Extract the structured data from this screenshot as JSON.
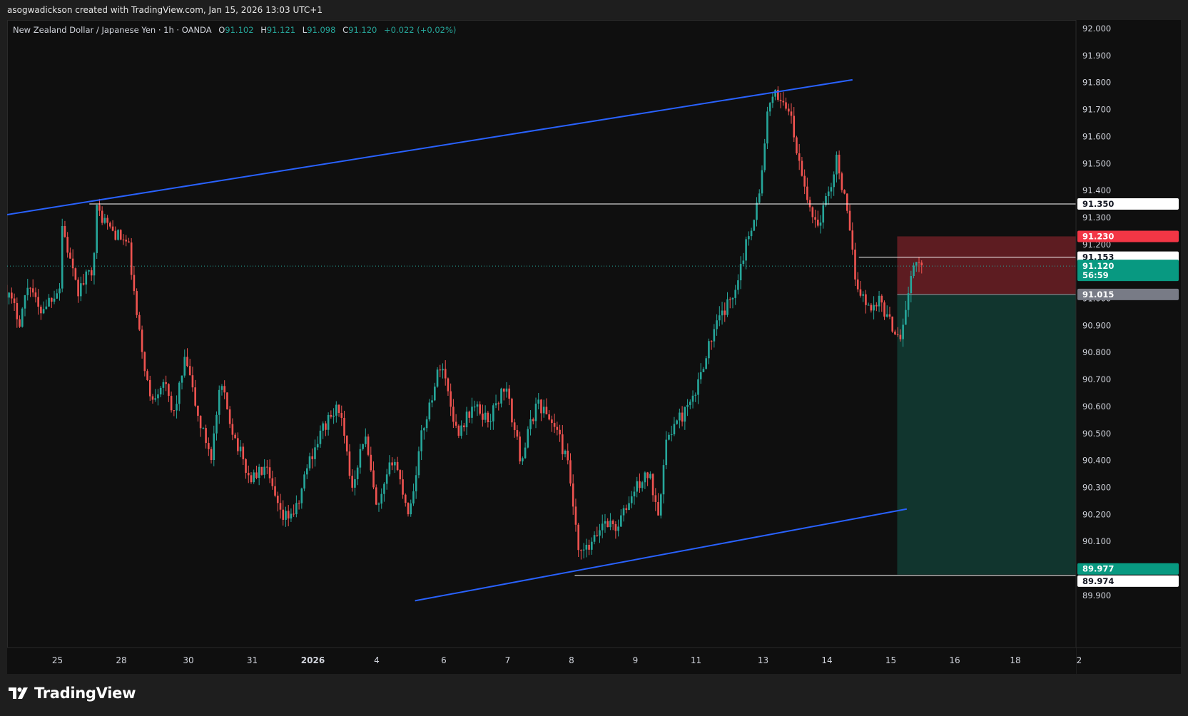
{
  "attribution": "asogwadickson created with TradingView.com, Jan 15, 2026 13:03 UTC+1",
  "legend": {
    "symbol": "New Zealand Dollar / Japanese Yen · 1h · OANDA",
    "o_label": "O",
    "o_value": "91.102",
    "h_label": "H",
    "h_value": "91.121",
    "l_label": "L",
    "l_value": "91.098",
    "c_label": "C",
    "c_value": "91.120",
    "change": "+0.022 (+0.02%)"
  },
  "logo_text": "TradingView",
  "colors": {
    "up": "#26a69a",
    "down": "#ef5350",
    "trendline": "#2962ff",
    "level": "#ffffff",
    "stop_zone": "#6b1f25",
    "target_zone": "#123a32",
    "stop_tag": "#f23645",
    "current_tag": "#089981",
    "entry_tag": "#787b86",
    "target_tag": "#089981"
  },
  "chart_data": {
    "type": "candlestick",
    "y_axis": {
      "range": [
        89.88,
        92.04
      ],
      "ticks": [
        "92.000",
        "91.900",
        "91.800",
        "91.700",
        "91.600",
        "91.500",
        "91.400",
        "91.300",
        "91.200",
        "91.100",
        "91.000",
        "90.900",
        "90.800",
        "90.700",
        "90.600",
        "90.500",
        "90.400",
        "90.300",
        "90.200",
        "90.100",
        "90.000",
        "89.900"
      ]
    },
    "x_axis": {
      "ticks": [
        {
          "label": "25",
          "t": 0.0
        },
        {
          "label": "28",
          "t": 1.0
        },
        {
          "label": "30",
          "t": 2.05
        },
        {
          "label": "31",
          "t": 3.05
        },
        {
          "label": "2026",
          "t": 4.0,
          "bold": true
        },
        {
          "label": "4",
          "t": 5.0
        },
        {
          "label": "6",
          "t": 6.05
        },
        {
          "label": "7",
          "t": 7.05
        },
        {
          "label": "8",
          "t": 8.05
        },
        {
          "label": "9",
          "t": 9.05
        },
        {
          "label": "11",
          "t": 10.0
        },
        {
          "label": "13",
          "t": 11.05
        },
        {
          "label": "14",
          "t": 12.05
        },
        {
          "label": "15",
          "t": 13.05
        },
        {
          "label": "16",
          "t": 14.05
        },
        {
          "label": "18",
          "t": 15.0
        },
        {
          "label": "2",
          "t": 16.0
        }
      ]
    },
    "price_path": [
      [
        -0.8,
        91.05
      ],
      [
        -0.55,
        90.92
      ],
      [
        -0.4,
        91.07
      ],
      [
        -0.25,
        90.95
      ],
      [
        0.1,
        91.05
      ],
      [
        0.1,
        91.29
      ],
      [
        0.35,
        91.02
      ],
      [
        0.6,
        91.12
      ],
      [
        0.65,
        91.33
      ],
      [
        0.9,
        91.25
      ],
      [
        1.15,
        91.2
      ],
      [
        1.3,
        90.9
      ],
      [
        1.5,
        90.62
      ],
      [
        1.7,
        90.7
      ],
      [
        1.85,
        90.56
      ],
      [
        2.05,
        90.78
      ],
      [
        2.25,
        90.55
      ],
      [
        2.45,
        90.42
      ],
      [
        2.6,
        90.68
      ],
      [
        2.8,
        90.5
      ],
      [
        3.05,
        90.33
      ],
      [
        3.3,
        90.37
      ],
      [
        3.55,
        90.18
      ],
      [
        3.8,
        90.22
      ],
      [
        3.95,
        90.38
      ],
      [
        4.2,
        90.52
      ],
      [
        4.45,
        90.6
      ],
      [
        4.65,
        90.3
      ],
      [
        4.85,
        90.5
      ],
      [
        5.05,
        90.2
      ],
      [
        5.3,
        90.42
      ],
      [
        5.55,
        90.2
      ],
      [
        5.75,
        90.5
      ],
      [
        6.05,
        90.77
      ],
      [
        6.3,
        90.5
      ],
      [
        6.55,
        90.6
      ],
      [
        6.8,
        90.55
      ],
      [
        7.05,
        90.68
      ],
      [
        7.3,
        90.4
      ],
      [
        7.55,
        90.62
      ],
      [
        7.85,
        90.52
      ],
      [
        8.05,
        90.37
      ],
      [
        8.2,
        90.05
      ],
      [
        8.4,
        90.08
      ],
      [
        8.6,
        90.18
      ],
      [
        8.8,
        90.15
      ],
      [
        9.1,
        90.3
      ],
      [
        9.3,
        90.35
      ],
      [
        9.45,
        90.22
      ],
      [
        9.6,
        90.5
      ],
      [
        9.8,
        90.56
      ],
      [
        10.0,
        90.62
      ],
      [
        10.2,
        90.8
      ],
      [
        10.4,
        90.92
      ],
      [
        10.6,
        91.0
      ],
      [
        10.85,
        91.22
      ],
      [
        11.05,
        91.4
      ],
      [
        11.15,
        91.68
      ],
      [
        11.3,
        91.76
      ],
      [
        11.5,
        91.7
      ],
      [
        11.65,
        91.5
      ],
      [
        11.8,
        91.35
      ],
      [
        11.95,
        91.27
      ],
      [
        12.1,
        91.38
      ],
      [
        12.25,
        91.52
      ],
      [
        12.4,
        91.32
      ],
      [
        12.55,
        91.06
      ],
      [
        12.75,
        90.96
      ],
      [
        12.9,
        91.0
      ],
      [
        13.1,
        90.9
      ],
      [
        13.25,
        90.86
      ],
      [
        13.35,
        91.0
      ],
      [
        13.45,
        91.12
      ],
      [
        13.55,
        91.12
      ]
    ],
    "trendlines": [
      {
        "from": [
          -0.8,
          91.31
        ],
        "to": [
          12.45,
          91.81
        ]
      },
      {
        "from": [
          5.6,
          89.88
        ],
        "to": [
          13.3,
          90.22
        ]
      }
    ],
    "horizontal_levels": [
      {
        "price": 91.35,
        "from_t": 0.5,
        "label": "91.350"
      },
      {
        "price": 91.153,
        "from_t": 12.55,
        "label": "91.153"
      },
      {
        "price": 89.974,
        "from_t": 8.1,
        "label": "89.974"
      }
    ],
    "position": {
      "type": "short",
      "entry": 91.015,
      "stop": 91.23,
      "target": 89.977,
      "start_t": 13.15,
      "current": 91.12,
      "countdown": "56:59"
    },
    "price_tags": [
      {
        "price": 91.35,
        "label": "91.350",
        "style": "level"
      },
      {
        "price": 91.23,
        "label": "91.230",
        "style": "stop"
      },
      {
        "price": 91.153,
        "label": "91.153",
        "style": "level"
      },
      {
        "price": 91.12,
        "label": "91.120",
        "style": "current"
      },
      {
        "price": 91.015,
        "label": "91.015",
        "style": "entry"
      },
      {
        "price": 89.977,
        "label": "89.977",
        "style": "target"
      },
      {
        "price": 89.974,
        "label": "89.974",
        "style": "level"
      }
    ]
  }
}
